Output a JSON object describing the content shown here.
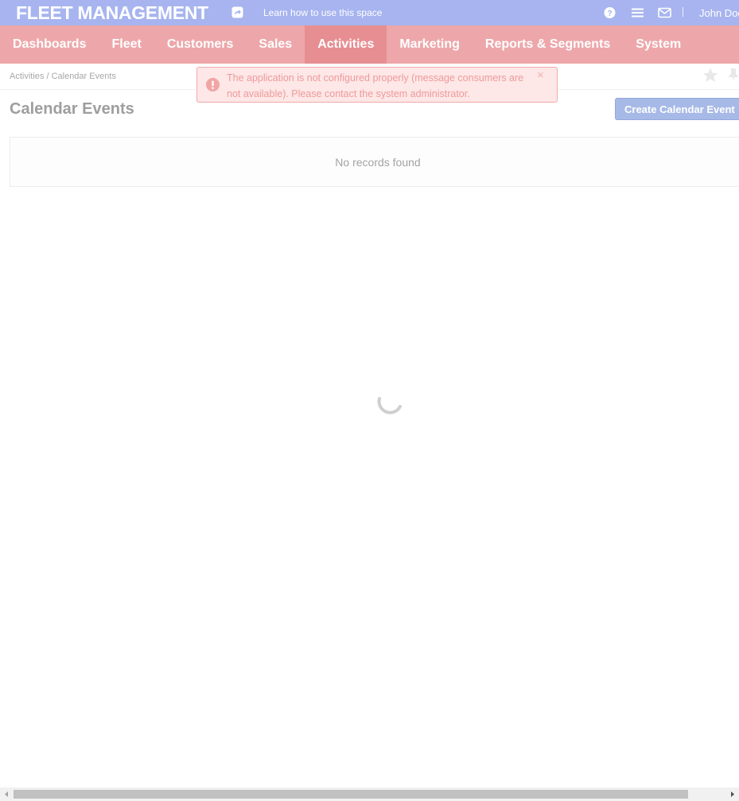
{
  "app": {
    "title": "FLEET MANAGEMENT",
    "learn_link": "Learn how to use this space",
    "user_name": "John Doe",
    "icons": [
      "share-icon",
      "help-icon",
      "menu-icon",
      "mail-icon"
    ]
  },
  "nav": {
    "items": [
      {
        "label": "Dashboards",
        "active": false
      },
      {
        "label": "Fleet",
        "active": false
      },
      {
        "label": "Customers",
        "active": false
      },
      {
        "label": "Sales",
        "active": false
      },
      {
        "label": "Activities",
        "active": true
      },
      {
        "label": "Marketing",
        "active": false
      },
      {
        "label": "Reports & Segments",
        "active": false
      },
      {
        "label": "System",
        "active": false
      }
    ]
  },
  "breadcrumb": "Activities / Calendar Events",
  "page": {
    "title": "Calendar Events",
    "create_button": "Create Calendar Event",
    "empty_message": "No records found"
  },
  "flash": {
    "message": "The application is not configured properly (message consumers are not available). Please contact the system administrator.",
    "close": "×"
  },
  "colors": {
    "topbar": "#a7b4ef",
    "nav": "#eda7aa",
    "nav_active": "#e78e92",
    "error": "#ef9a9a"
  }
}
